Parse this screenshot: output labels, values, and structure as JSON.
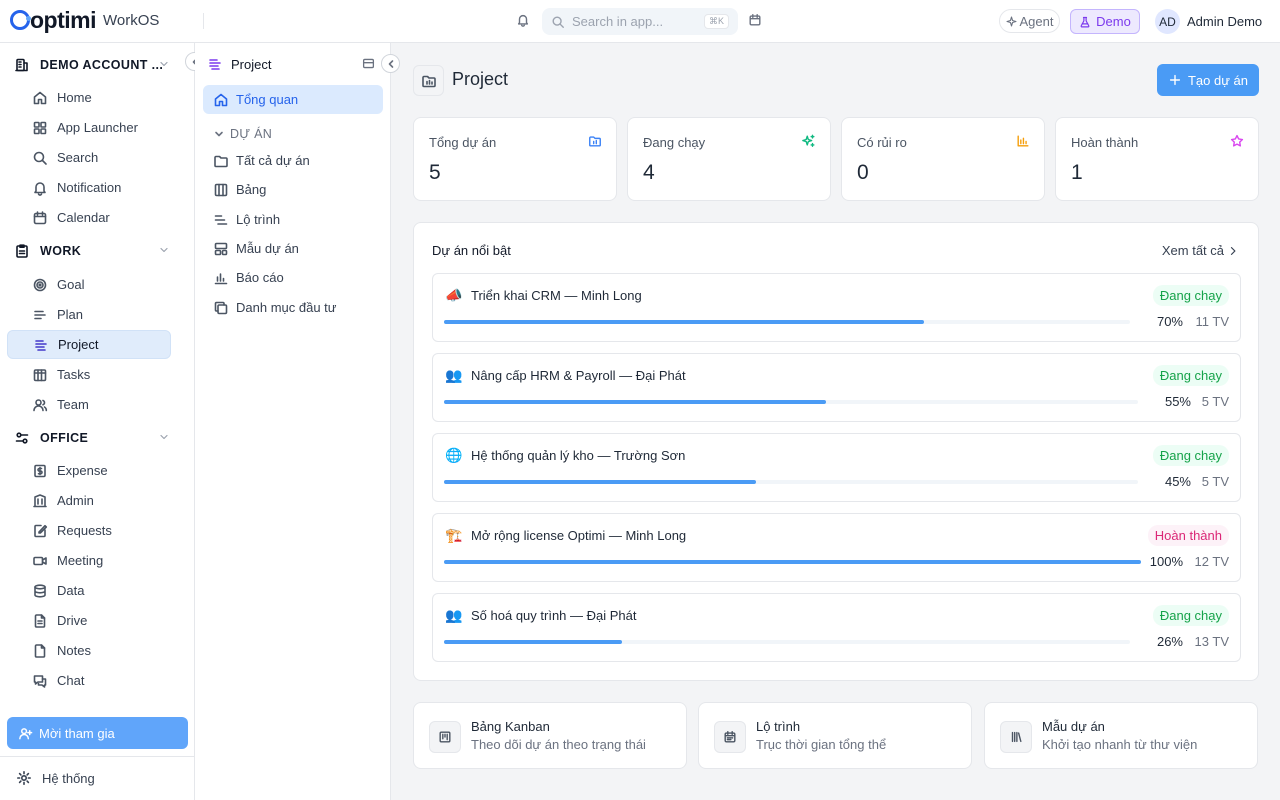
{
  "app": {
    "logo": "optimi",
    "product": "WorkOS"
  },
  "topbar": {
    "search_placeholder": "Search in app...",
    "search_shortcut": "⌘K",
    "agent_label": "Agent",
    "demo_label": "Demo",
    "user_initials": "AD",
    "user_name": "Admin Demo"
  },
  "sidebar": {
    "account": "DEMO ACCOUNT ...",
    "top_items": [
      {
        "label": "Home",
        "icon": "home-icon"
      },
      {
        "label": "App Launcher",
        "icon": "grid-icon"
      },
      {
        "label": "Search",
        "icon": "search-icon"
      },
      {
        "label": "Notification",
        "icon": "bell-icon"
      },
      {
        "label": "Calendar",
        "icon": "calendar-icon"
      }
    ],
    "work_label": "WORK",
    "work_items": [
      {
        "label": "Goal",
        "icon": "target-icon"
      },
      {
        "label": "Plan",
        "icon": "lines-icon"
      },
      {
        "label": "Project",
        "icon": "project-icon"
      },
      {
        "label": "Tasks",
        "icon": "tasks-icon"
      },
      {
        "label": "Team",
        "icon": "users-icon"
      }
    ],
    "office_label": "OFFICE",
    "office_items": [
      {
        "label": "Expense",
        "icon": "dollar-icon"
      },
      {
        "label": "Admin",
        "icon": "building-icon"
      },
      {
        "label": "Requests",
        "icon": "edit-icon"
      },
      {
        "label": "Meeting",
        "icon": "video-icon"
      },
      {
        "label": "Data",
        "icon": "database-icon"
      },
      {
        "label": "Drive",
        "icon": "file-icon"
      },
      {
        "label": "Notes",
        "icon": "note-icon"
      },
      {
        "label": "Chat",
        "icon": "chat-icon"
      }
    ],
    "invite_label": "Mời tham gia",
    "settings_label": "Hệ thống"
  },
  "subnav": {
    "title": "Project",
    "overview": "Tổng quan",
    "group_label": "DỰ ÁN",
    "items": [
      {
        "label": "Tất cả dự án",
        "icon": "folder-icon"
      },
      {
        "label": "Bảng",
        "icon": "columns-icon"
      },
      {
        "label": "Lộ trình",
        "icon": "timeline-icon"
      },
      {
        "label": "Mẫu dự án",
        "icon": "template-icon"
      },
      {
        "label": "Báo cáo",
        "icon": "bar-chart-icon"
      },
      {
        "label": "Danh mục đầu tư",
        "icon": "copy-icon"
      }
    ]
  },
  "page": {
    "title": "Project",
    "create_label": "Tạo dự án"
  },
  "stats": [
    {
      "label": "Tổng dự án",
      "value": "5",
      "icon": "folder-chart-icon",
      "color": "#3b82f6"
    },
    {
      "label": "Đang chạy",
      "value": "4",
      "icon": "sparkle-icon",
      "color": "#10b981"
    },
    {
      "label": "Có rủi ro",
      "value": "0",
      "icon": "bar-chart-icon",
      "color": "#f59e0b"
    },
    {
      "label": "Hoàn thành",
      "value": "1",
      "icon": "star-icon",
      "color": "#d946ef"
    }
  ],
  "featured": {
    "title": "Dự án nổi bật",
    "see_all": "Xem tất cả",
    "projects": [
      {
        "emoji": "📣",
        "name": "Triển khai CRM — Minh Long",
        "status": "Đang chạy",
        "status_kind": "run",
        "progress": 70,
        "progress_label": "70%",
        "members": "11 TV"
      },
      {
        "emoji": "👥",
        "name": "Nâng cấp HRM & Payroll — Đại Phát",
        "status": "Đang chạy",
        "status_kind": "run",
        "progress": 55,
        "progress_label": "55%",
        "members": "5 TV"
      },
      {
        "emoji": "🌐",
        "name": "Hệ thống quản lý kho — Trường Sơn",
        "status": "Đang chạy",
        "status_kind": "run",
        "progress": 45,
        "progress_label": "45%",
        "members": "5 TV"
      },
      {
        "emoji": "🏗️",
        "name": "Mở rộng license Optimi — Minh Long",
        "status": "Hoàn thành",
        "status_kind": "done",
        "progress": 100,
        "progress_label": "100%",
        "members": "12 TV"
      },
      {
        "emoji": "👥",
        "name": "Số hoá quy trình — Đại Phát",
        "status": "Đang chạy",
        "status_kind": "run",
        "progress": 26,
        "progress_label": "26%",
        "members": "13 TV"
      }
    ]
  },
  "quick_links": [
    {
      "title": "Bảng Kanban",
      "subtitle": "Theo dõi dự án theo trạng thái",
      "icon": "kanban-icon"
    },
    {
      "title": "Lộ trình",
      "subtitle": "Trục thời gian tổng thể",
      "icon": "calendar-icon"
    },
    {
      "title": "Mẫu dự án",
      "subtitle": "Khởi tạo nhanh từ thư viện",
      "icon": "library-icon"
    }
  ]
}
